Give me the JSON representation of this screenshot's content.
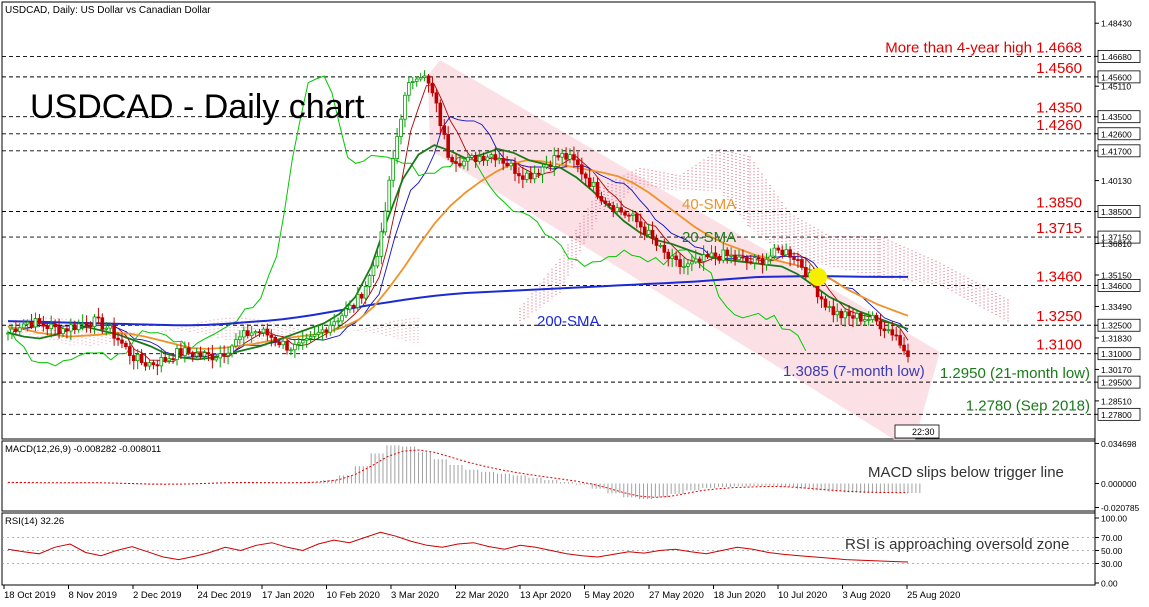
{
  "header": {
    "symbol_label": "USDCAD, Daily:  US Dollar vs Canadian Dollar",
    "big_title": "USDCAD - Daily chart",
    "time_badge": "22:30"
  },
  "colors": {
    "channel_fill": "#f9d7dd",
    "sma200": "#1c2bd1",
    "sma40": "#f0922a",
    "sma20": "#1a7a1a",
    "chikou": "#00c800",
    "kijun": "#1010c0",
    "tenkan": "#b00000",
    "cloud": "#e05070",
    "level_text": "#e00000",
    "annotation_green": "#1a7a1a",
    "annotation_blue": "#3b3bb0",
    "macd_hist": "#a0a0a0",
    "macd_signal": "#e00000",
    "rsi_line": "#cc0000",
    "bull_candle": "#00a000",
    "bear_candle": "#c00000",
    "highlight_dot": "#f6f000"
  },
  "chart_data": [
    {
      "type": "candlestick",
      "title": "USDCAD - Daily chart",
      "ylim": [
        1.265,
        1.4955
      ],
      "price_axis_ticks": [
        "1.48430",
        "1.46680",
        "1.45600",
        "1.45110",
        "1.43500",
        "1.42600",
        "1.41700",
        "1.40130",
        "1.38500",
        "1.37150",
        "1.36810",
        "1.35150",
        "1.34600",
        "1.33490",
        "1.32500",
        "1.31830",
        "1.31000",
        "1.30170",
        "1.29500",
        "1.28510",
        "1.27800"
      ],
      "price_axis_highlighted": [
        "1.46680",
        "1.45600",
        "1.43500",
        "1.42600",
        "1.41700",
        "1.38500",
        "1.37150",
        "1.34600",
        "1.32500",
        "1.31000",
        "1.29500",
        "1.27800"
      ],
      "date_axis_labels": [
        "18 Oct 2019",
        "8 Nov 2019",
        "2 Dec 2019",
        "24 Dec 2019",
        "17 Jan 2020",
        "10 Feb 2020",
        "3 Mar 2020",
        "22 Mar 2020",
        "13 Apr 2020",
        "5 May 2020",
        "27 May 2020",
        "18 Jun 2020",
        "10 Jul 2020",
        "3 Aug 2020",
        "25 Aug 2020"
      ],
      "horizontal_levels": [
        {
          "value": 1.4668,
          "label": "More than 4-year high 1.4668"
        },
        {
          "value": 1.456,
          "label": "1.4560"
        },
        {
          "value": 1.435,
          "label": "1.4350"
        },
        {
          "value": 1.426,
          "label": "1.4260"
        },
        {
          "value": 1.417,
          "label": ""
        },
        {
          "value": 1.385,
          "label": "1.3850"
        },
        {
          "value": 1.3715,
          "label": "1.3715"
        },
        {
          "value": 1.346,
          "label": "1.3460"
        },
        {
          "value": 1.325,
          "label": "1.3250"
        },
        {
          "value": 1.31,
          "label": "1.3100"
        },
        {
          "value": 1.295,
          "label": "1.2950 (21-month low)"
        },
        {
          "value": 1.278,
          "label": "1.2780 (Sep 2018)"
        }
      ],
      "annotations": {
        "sma40": "40-SMA",
        "sma20": "20-SMA",
        "sma200": "200-SMA",
        "low_7m": "1.3085 (7-month low)"
      },
      "series": [
        {
          "name": "200-SMA",
          "y": [
            1.3272,
            1.327,
            1.3268,
            1.3266,
            1.3264,
            1.3262,
            1.326,
            1.3258,
            1.3256,
            1.3254,
            1.3252,
            1.325,
            1.325,
            1.3252,
            1.3256,
            1.3262,
            1.3268,
            1.3274,
            1.3282,
            1.3292,
            1.3304,
            1.3318,
            1.3332,
            1.3346,
            1.336,
            1.3372,
            1.3384,
            1.3396,
            1.3406,
            1.3414,
            1.342,
            1.3424,
            1.3428,
            1.3432,
            1.3436,
            1.344,
            1.3444,
            1.3448,
            1.3452,
            1.3456,
            1.346,
            1.3464,
            1.3468,
            1.3472,
            1.3476,
            1.348,
            1.3486,
            1.3492,
            1.3498,
            1.3504,
            1.3506,
            1.3507,
            1.3508,
            1.3508,
            1.3508,
            1.3507,
            1.3506,
            1.3505,
            1.3505,
            1.3505
          ]
        },
        {
          "name": "40-SMA",
          "y": [
            1.324,
            1.323,
            1.321,
            1.32,
            1.319,
            1.3195,
            1.32,
            1.321,
            1.3205,
            1.319,
            1.317,
            1.315,
            1.313,
            1.3125,
            1.313,
            1.314,
            1.315,
            1.3165,
            1.318,
            1.319,
            1.32,
            1.3215,
            1.324,
            1.328,
            1.335,
            1.345,
            1.356,
            1.368,
            1.379,
            1.388,
            1.395,
            1.401,
            1.406,
            1.41,
            1.412,
            1.4115,
            1.41,
            1.4085,
            1.407,
            1.4055,
            1.4035,
            1.4,
            1.395,
            1.389,
            1.383,
            1.377,
            1.372,
            1.368,
            1.365,
            1.362,
            1.36,
            1.358,
            1.356,
            1.353,
            1.349,
            1.344,
            1.34,
            1.336,
            1.333,
            1.33
          ]
        },
        {
          "name": "20-SMA",
          "y": [
            1.321,
            1.319,
            1.318,
            1.32,
            1.323,
            1.324,
            1.322,
            1.32,
            1.317,
            1.314,
            1.31,
            1.308,
            1.307,
            1.308,
            1.31,
            1.312,
            1.314,
            1.317,
            1.32,
            1.323,
            1.326,
            1.331,
            1.34,
            1.356,
            1.38,
            1.402,
            1.415,
            1.42,
            1.417,
            1.413,
            1.415,
            1.418,
            1.416,
            1.412,
            1.41,
            1.408,
            1.403,
            1.396,
            1.388,
            1.38,
            1.374,
            1.37,
            1.368,
            1.365,
            1.362,
            1.36,
            1.359,
            1.358,
            1.357,
            1.356,
            1.352,
            1.346,
            1.34,
            1.336,
            1.332,
            1.329,
            1.326,
            1.323
          ]
        }
      ]
    },
    {
      "type": "histogram",
      "title": "MACD(12,26,9) -0.008282 -0.008011",
      "annotation": "MACD slips below trigger line",
      "ylim": [
        -0.0238,
        0.0368
      ],
      "axis_ticks": [
        "0.034698",
        "0.000000",
        "-0.020785"
      ],
      "values": [
        0.0012,
        0.0008,
        0.0004,
        0.0006,
        0.001,
        0.0008,
        0.0002,
        -0.0004,
        -0.0008,
        -0.001,
        -0.0006,
        -0.0002,
        0.0004,
        0.001,
        0.0012,
        0.001,
        0.0006,
        0.0004,
        0.0006,
        0.0012,
        0.003,
        0.007,
        0.015,
        0.026,
        0.033,
        0.032,
        0.027,
        0.021,
        0.016,
        0.012,
        0.01,
        0.0085,
        0.007,
        0.005,
        0.003,
        0.0012,
        -0.001,
        -0.0045,
        -0.0085,
        -0.012,
        -0.0135,
        -0.012,
        -0.009,
        -0.006,
        -0.004,
        -0.003,
        -0.0025,
        -0.0022,
        -0.002,
        -0.003,
        -0.0045,
        -0.006,
        -0.007,
        -0.0078,
        -0.0082,
        -0.0083,
        -0.0083,
        -0.0083
      ],
      "signal": [
        0.001,
        0.0009,
        0.0007,
        0.0006,
        0.0007,
        0.0007,
        0.0006,
        0.0003,
        -0.0001,
        -0.0005,
        -0.0006,
        -0.0005,
        -0.0002,
        0.0003,
        0.0007,
        0.0009,
        0.0008,
        0.0007,
        0.0007,
        0.0009,
        0.0016,
        0.0035,
        0.008,
        0.015,
        0.023,
        0.028,
        0.029,
        0.027,
        0.023,
        0.019,
        0.0155,
        0.0125,
        0.01,
        0.0078,
        0.0058,
        0.004,
        0.002,
        -0.0005,
        -0.004,
        -0.008,
        -0.011,
        -0.012,
        -0.011,
        -0.0085,
        -0.006,
        -0.0045,
        -0.0035,
        -0.003,
        -0.0026,
        -0.0027,
        -0.0034,
        -0.0045,
        -0.0056,
        -0.0066,
        -0.0073,
        -0.0077,
        -0.0079,
        -0.008
      ]
    },
    {
      "type": "line",
      "title": "RSI(14) 32.26",
      "annotation": "RSI is approaching oversold zone",
      "ylim": [
        0,
        100
      ],
      "axis_ticks": [
        "100.00",
        "70.00",
        "50.00",
        "30.00",
        "0.00"
      ],
      "reference_levels": [
        70,
        50,
        30
      ],
      "values": [
        52,
        48,
        45,
        55,
        60,
        47,
        42,
        50,
        56,
        48,
        40,
        36,
        41,
        47,
        55,
        50,
        58,
        62,
        55,
        50,
        60,
        66,
        62,
        70,
        78,
        72,
        64,
        58,
        55,
        60,
        62,
        56,
        52,
        58,
        55,
        50,
        45,
        42,
        40,
        44,
        48,
        46,
        50,
        52,
        48,
        45,
        50,
        55,
        52,
        47,
        44,
        42,
        40,
        38,
        36,
        35,
        34,
        33,
        32.26
      ]
    }
  ]
}
